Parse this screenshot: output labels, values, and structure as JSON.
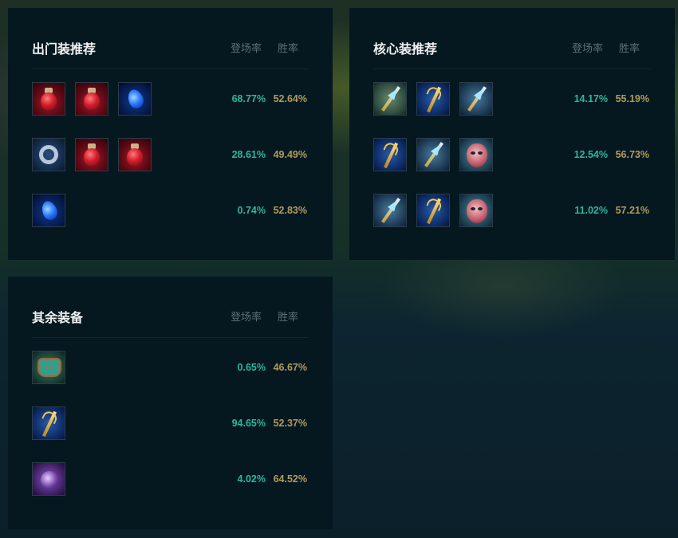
{
  "columns": {
    "pick_rate": "登场率",
    "win_rate": "胜率"
  },
  "starting": {
    "title": "出门装推荐",
    "rows": [
      {
        "items": [
          "red-potion-icon",
          "red-potion-icon",
          "tear-of-goddess-icon"
        ],
        "pick": "68.77%",
        "win": "52.64%"
      },
      {
        "items": [
          "dark-seal-ring-icon",
          "red-potion-icon",
          "red-potion-icon"
        ],
        "pick": "28.61%",
        "win": "49.49%"
      },
      {
        "items": [
          "tear-of-goddess-icon"
        ],
        "pick": "0.74%",
        "win": "52.83%"
      }
    ]
  },
  "core": {
    "title": "核心装推荐",
    "rows": [
      {
        "items": [
          "spear-icon",
          "golden-staff-icon",
          "lance-staff-icon"
        ],
        "pick": "14.17%",
        "win": "55.19%"
      },
      {
        "items": [
          "golden-staff-icon",
          "lance-staff-icon",
          "mask-icon"
        ],
        "pick": "12.54%",
        "win": "56.73%"
      },
      {
        "items": [
          "lance-staff-icon",
          "golden-staff-icon",
          "mask-icon"
        ],
        "pick": "11.02%",
        "win": "57.21%"
      }
    ]
  },
  "other": {
    "title": "其余装备",
    "rows": [
      {
        "items": [
          "armor-icon"
        ],
        "pick": "0.65%",
        "win": "46.67%"
      },
      {
        "items": [
          "golden-staff-icon"
        ],
        "pick": "94.65%",
        "win": "52.37%"
      },
      {
        "items": [
          "purple-hourglass-icon"
        ],
        "pick": "4.02%",
        "win": "64.52%"
      }
    ]
  }
}
